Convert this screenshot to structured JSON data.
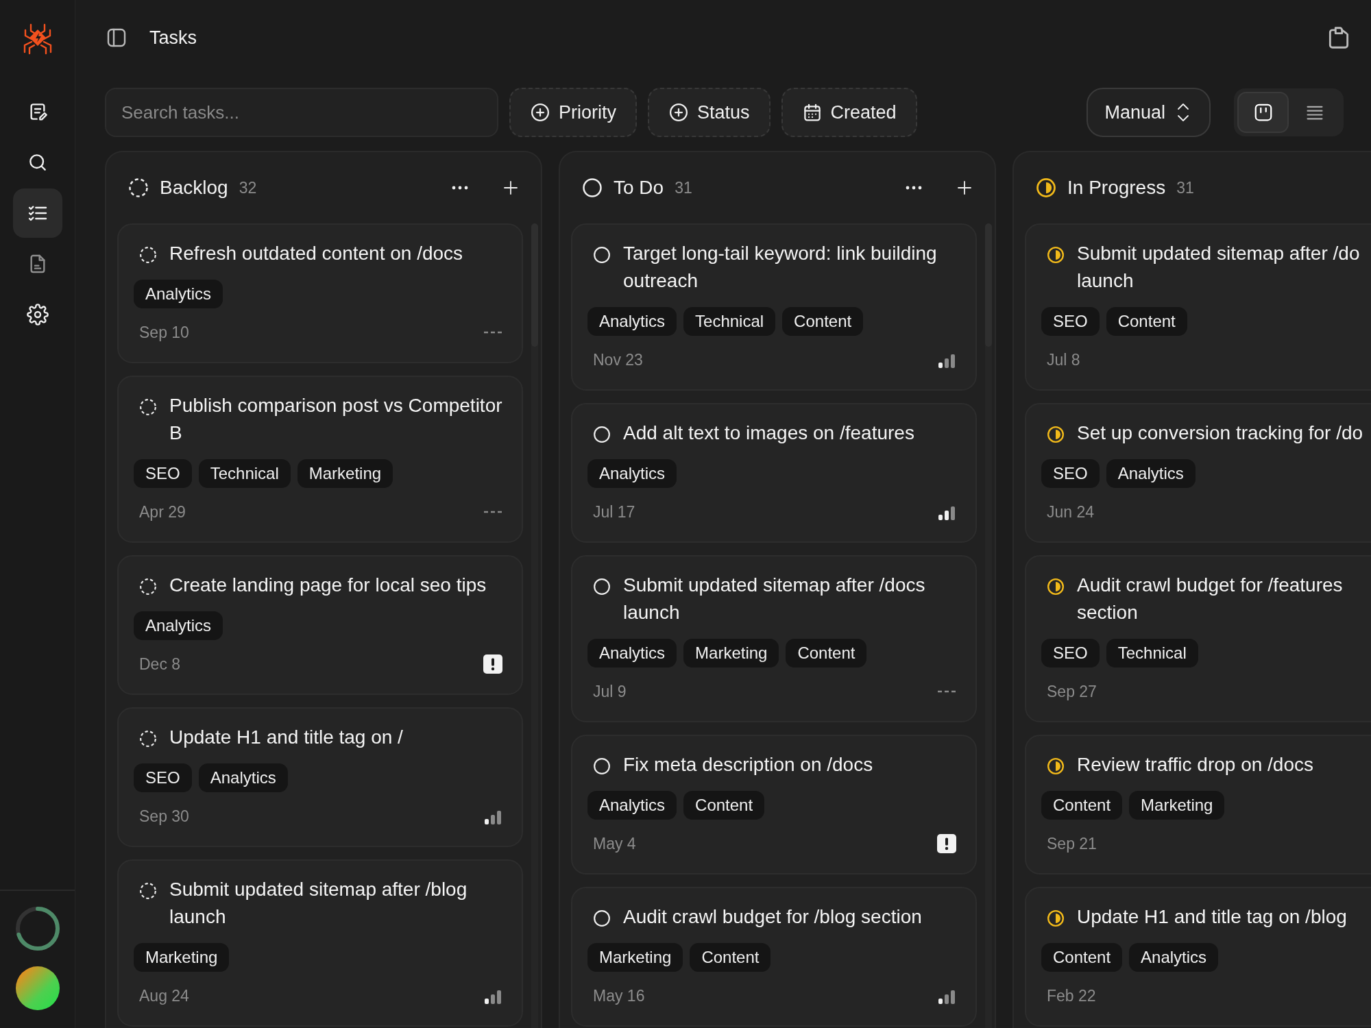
{
  "sidebar": {
    "items": [
      {
        "kind": "notes",
        "selected": false
      },
      {
        "kind": "search",
        "selected": false
      },
      {
        "kind": "tasks",
        "selected": true
      },
      {
        "kind": "document",
        "selected": false
      },
      {
        "kind": "settings",
        "selected": false
      }
    ],
    "usage": {
      "level": 0.7
    }
  },
  "header": {
    "title": "Tasks"
  },
  "toolbar": {
    "search": {
      "placeholder": "Search tasks..."
    },
    "filters": [
      {
        "kind": "add",
        "label": "Priority"
      },
      {
        "kind": "add",
        "label": "Status"
      },
      {
        "kind": "date",
        "label": "Created"
      }
    ],
    "sort": {
      "value": "Manual"
    },
    "views": [
      {
        "kind": "board",
        "selected": true
      },
      {
        "kind": "list",
        "selected": false
      }
    ]
  },
  "columns": [
    {
      "kind": "backlog",
      "title": "Backlog",
      "count": "32",
      "menu": true,
      "cards": [
        {
          "title": "Refresh outdated content on /docs",
          "tags": [
            "Analytics"
          ],
          "date": "Sep 10",
          "priority": {
            "kind": "none"
          }
        },
        {
          "title": "Publish comparison post vs Competitor B",
          "tags": [
            "SEO",
            "Technical",
            "Marketing"
          ],
          "date": "Apr 29",
          "priority": {
            "kind": "none"
          }
        },
        {
          "title": "Create landing page for local seo tips",
          "tags": [
            "Analytics"
          ],
          "date": "Dec 8",
          "priority": {
            "kind": "urgent"
          }
        },
        {
          "title": "Update H1 and title tag on /",
          "tags": [
            "SEO",
            "Analytics"
          ],
          "date": "Sep 30",
          "priority": {
            "kind": "low"
          }
        },
        {
          "title": "Submit updated sitemap after /blog launch",
          "tags": [
            "Marketing"
          ],
          "date": "Aug 24",
          "priority": {
            "kind": "low"
          }
        }
      ]
    },
    {
      "kind": "todo",
      "title": "To Do",
      "count": "31",
      "menu": true,
      "cards": [
        {
          "title": "Target long-tail keyword: link building outreach",
          "tags": [
            "Analytics",
            "Technical",
            "Content"
          ],
          "date": "Nov 23",
          "priority": {
            "kind": "low"
          }
        },
        {
          "title": "Add alt text to images on /features",
          "tags": [
            "Analytics"
          ],
          "date": "Jul 17",
          "priority": {
            "kind": "medium"
          }
        },
        {
          "title": "Submit updated sitemap after /docs launch",
          "tags": [
            "Analytics",
            "Marketing",
            "Content"
          ],
          "date": "Jul 9",
          "priority": {
            "kind": "none"
          }
        },
        {
          "title": "Fix meta description on /docs",
          "tags": [
            "Analytics",
            "Content"
          ],
          "date": "May 4",
          "priority": {
            "kind": "urgent"
          }
        },
        {
          "title": "Audit crawl budget for /blog section",
          "tags": [
            "Marketing",
            "Content"
          ],
          "date": "May 16",
          "priority": {
            "kind": "low"
          }
        }
      ]
    },
    {
      "kind": "in_progress",
      "title": "In Progress",
      "count": "31",
      "menu": false,
      "cards": [
        {
          "title": "Submit updated sitemap after /do launch",
          "tags": [
            "SEO",
            "Content"
          ],
          "date": "Jul 8"
        },
        {
          "title": "Set up conversion tracking for /do",
          "tags": [
            "SEO",
            "Analytics"
          ],
          "date": "Jun 24"
        },
        {
          "title": "Audit crawl budget for /features section",
          "tags": [
            "SEO",
            "Technical"
          ],
          "date": "Sep 27"
        },
        {
          "title": "Review traffic drop on /docs",
          "tags": [
            "Content",
            "Marketing"
          ],
          "date": "Sep 21"
        },
        {
          "title": "Update H1 and title tag on /blog",
          "tags": [
            "Content",
            "Analytics"
          ],
          "date": "Feb 22"
        }
      ]
    }
  ]
}
